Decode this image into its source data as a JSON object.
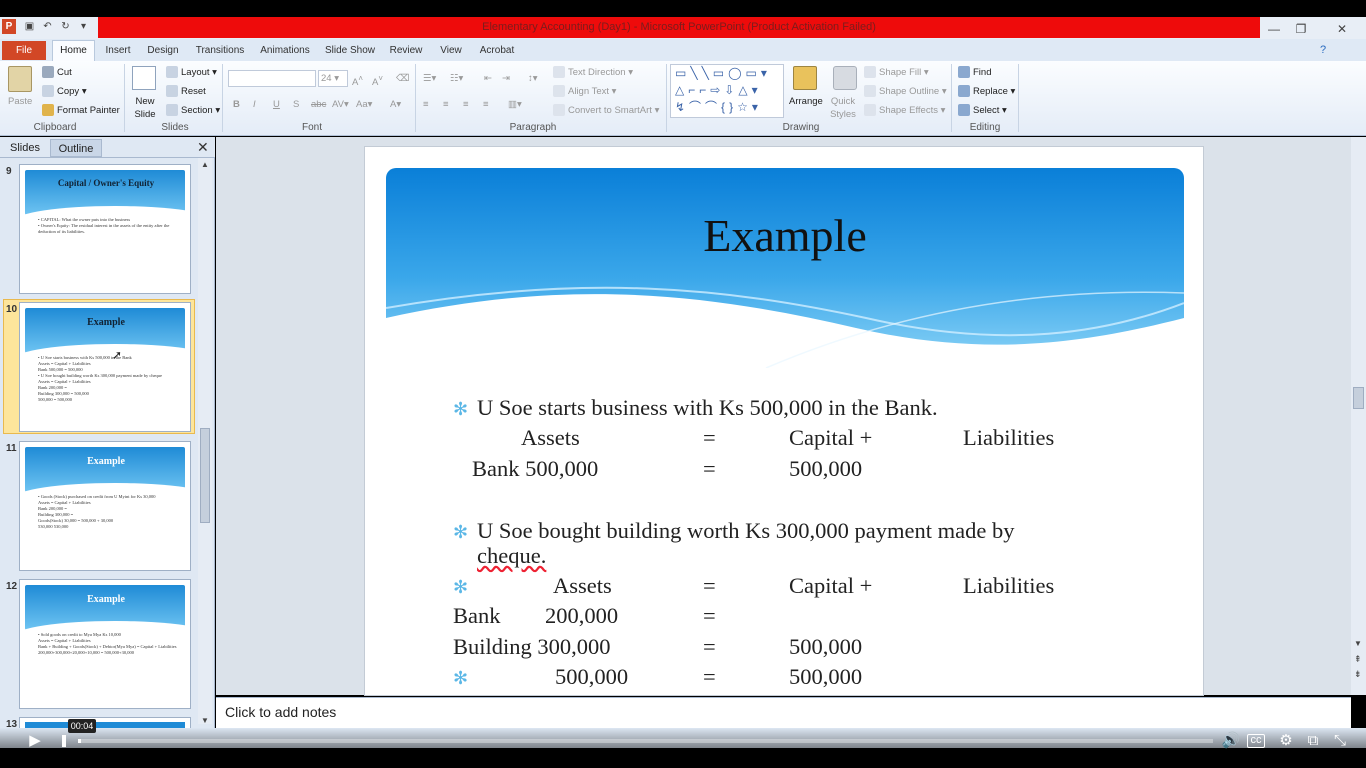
{
  "window": {
    "title": "Elementary Accounting (Day1) - Microsoft PowerPoint (Product Activation Failed)"
  },
  "tabs": [
    "File",
    "Home",
    "Insert",
    "Design",
    "Transitions",
    "Animations",
    "Slide Show",
    "Review",
    "View",
    "Acrobat"
  ],
  "ribbon": {
    "clipboard": {
      "label": "Clipboard",
      "paste": "Paste",
      "cut": "Cut",
      "copy": "Copy",
      "format_painter": "Format Painter"
    },
    "slides": {
      "label": "Slides",
      "new_slide": "New Slide",
      "layout": "Layout",
      "reset": "Reset",
      "section": "Section"
    },
    "font": {
      "label": "Font",
      "size": "24"
    },
    "paragraph": {
      "label": "Paragraph",
      "text_direction": "Text Direction",
      "align_text": "Align Text",
      "convert": "Convert to SmartArt"
    },
    "drawing": {
      "label": "Drawing",
      "arrange": "Arrange",
      "quick_styles": "Quick Styles",
      "shape_fill": "Shape Fill",
      "shape_outline": "Shape Outline",
      "shape_effects": "Shape Effects"
    },
    "editing": {
      "label": "Editing",
      "find": "Find",
      "replace": "Replace",
      "select": "Select"
    }
  },
  "pane": {
    "tabs": [
      "Slides",
      "Outline"
    ],
    "thumbnails": [
      {
        "number": "9",
        "title": "Capital / Owner's Equity",
        "lines": [
          "• CAPITAL: What the owner puts into the business",
          "• Owner's Equity: The residual interest in the assets of the entity after the deduction of its liabilities."
        ]
      },
      {
        "number": "10",
        "title": "Example",
        "lines": [
          "• U Soe starts business with Ks 500,000 in the Bank",
          "Assets = Capital + Liabilities",
          "Bank 500,000 = 500,000",
          "• U Soe bought building worth Ks 300,000 payment made by cheque",
          "Assets = Capital + Liabilities",
          "Bank 200,000 =",
          "Building 300,000 = 500,000",
          "500,000 = 500,000"
        ]
      },
      {
        "number": "11",
        "title": "Example",
        "lines": [
          "• Goods (Stock) purchased on credit from U Myint for Ks 30,000",
          "Assets = Capital + Liabilities",
          "Bank 200,000 =",
          "Building 300,000 =",
          "Goods(Stock) 30,000 = 500,000 + 30,000",
          "530,000 530,000"
        ]
      },
      {
        "number": "12",
        "title": "Example",
        "lines": [
          "• Sold goods on credit to Mya Mya Ks 10,000",
          "Assets = Capital + Liabilities",
          "Bank + Building + Goods(Stock) + Debtor(Mya Mya) = Capital + Liabilities",
          "200,000+300,000+20,000+10,000 = 500,000+30,000"
        ]
      },
      {
        "number": "13"
      }
    ]
  },
  "slide": {
    "title": "Example",
    "lines": [
      "U Soe starts business  with Ks 500,000 in the Bank.",
      "Assets",
      "=",
      "Capital  +",
      "Liabilities",
      "Bank 500,000",
      "=",
      "500,000",
      "U Soe bought building  worth Ks 300,000 payment made by",
      "cheque.",
      "Assets",
      "=",
      "Capital  +",
      "Liabilities",
      "Bank",
      "200,000",
      "=",
      "Building  300,000",
      "=",
      "500,000",
      "500,000",
      "=",
      "500,000"
    ]
  },
  "notes": {
    "placeholder": "Click to add notes"
  },
  "video": {
    "time": "00:04",
    "progress_fraction": 0.003
  }
}
